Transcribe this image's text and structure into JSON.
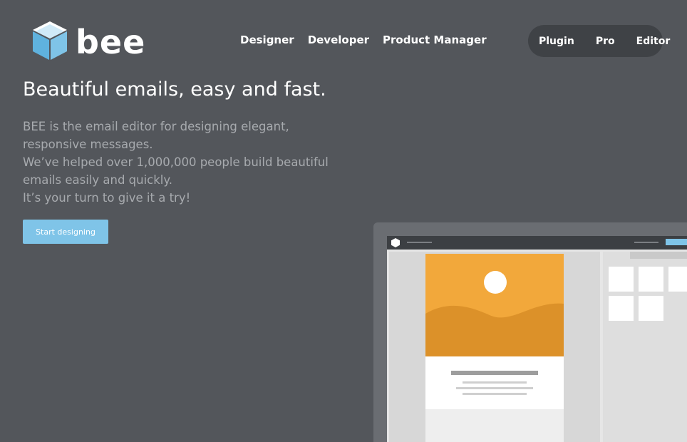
{
  "brand": {
    "name": "bee",
    "accent": "#7fc4e8",
    "background": "#53565b"
  },
  "nav": {
    "audience_links": [
      "Designer",
      "Developer",
      "Product Manager"
    ],
    "products": [
      "Plugin",
      "Pro",
      "Editor"
    ]
  },
  "hero": {
    "headline": "Beautiful emails, easy and fast.",
    "description_lines": [
      "BEE is the email editor for designing elegant,",
      "responsive messages.",
      "We’ve helped over 1,000,000 people build beautiful",
      "emails easily and quickly.",
      "It’s your turn to give it a try!"
    ],
    "cta_label": "Start designing"
  },
  "mockup": {
    "image_color": "#f2a83b",
    "hill_color": "#dc9129"
  }
}
